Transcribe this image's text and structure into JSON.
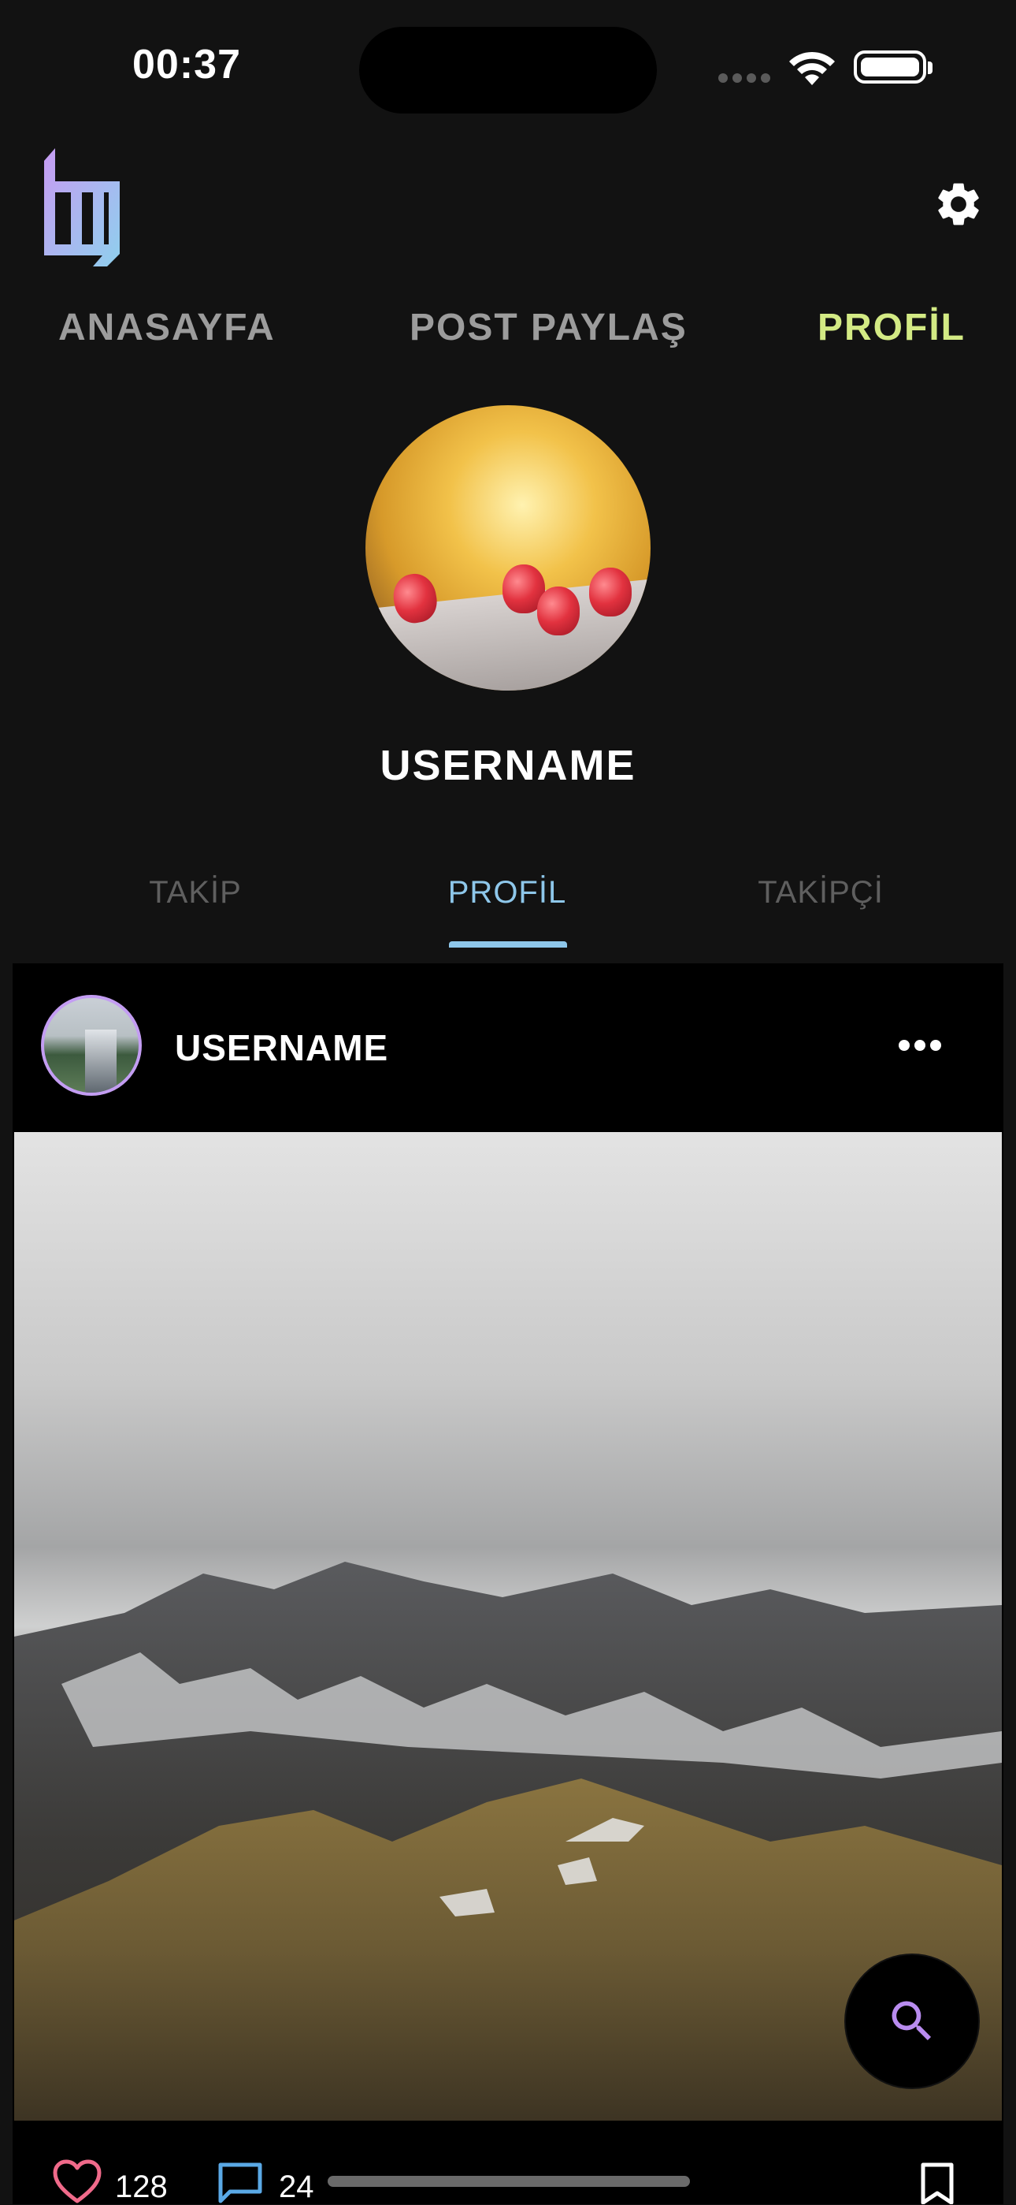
{
  "status_bar": {
    "time": "00:37"
  },
  "nav": {
    "items": [
      {
        "label": "ANASAYFA"
      },
      {
        "label": "POST PAYLAŞ"
      },
      {
        "label": "PROFİL"
      }
    ],
    "active_index": 2
  },
  "profile": {
    "username": "USERNAME"
  },
  "tabs": {
    "items": [
      {
        "label": "TAKİP"
      },
      {
        "label": "PROFİL"
      },
      {
        "label": "TAKİPÇİ"
      }
    ],
    "active_index": 1
  },
  "post": {
    "username": "USERNAME",
    "like_count": "128",
    "comment_count": "24"
  },
  "icons": {
    "logo": "app-logo",
    "settings": "gear-icon",
    "more": "more-horizontal-icon",
    "like": "heart-icon",
    "comment": "comment-icon",
    "bookmark": "bookmark-icon",
    "search": "search-icon"
  },
  "colors": {
    "background": "#121212",
    "active_nav": "#d3ea84",
    "active_tab": "#8ec7ea",
    "like": "#f06a8a",
    "comment": "#5aa9e6",
    "search": "#b98cf0",
    "avatar_ring": "#c39df2"
  }
}
